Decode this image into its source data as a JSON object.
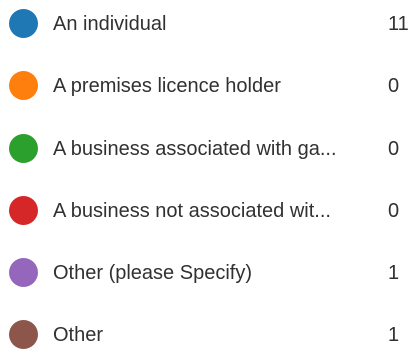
{
  "legend": {
    "items": [
      {
        "label": "An individual",
        "count": "11",
        "color": "#1f77b4"
      },
      {
        "label": "A premises licence holder",
        "count": "0",
        "color": "#ff7f0e"
      },
      {
        "label": "A business associated with ga...",
        "count": "0",
        "color": "#2ca02c"
      },
      {
        "label": "A business not associated wit...",
        "count": "0",
        "color": "#d62728"
      },
      {
        "label": "Other (please Specify)",
        "count": "1",
        "color": "#9467bd"
      },
      {
        "label": "Other",
        "count": "1",
        "color": "#8c564b"
      }
    ]
  }
}
